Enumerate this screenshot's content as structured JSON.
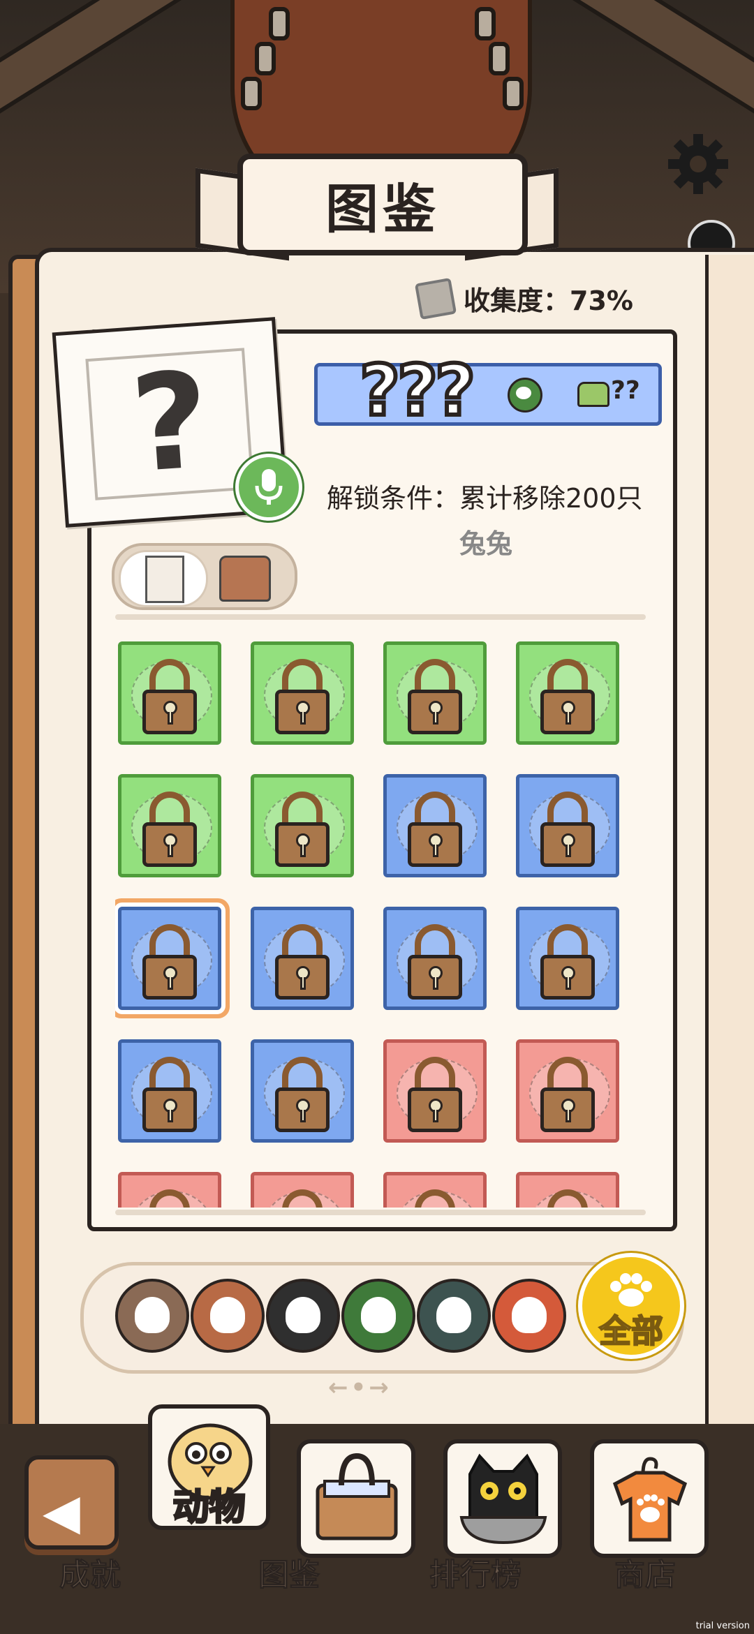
{
  "header": {
    "title": "图鉴"
  },
  "collection": {
    "label": "收集度：73%",
    "progress_percent": 73
  },
  "detail": {
    "name": "???",
    "food_count": "??",
    "photo_symbol": "?",
    "unlock_condition": "解锁条件：累计移除200只",
    "unlock_target": "兔兔"
  },
  "grid": {
    "rows": [
      [
        "green",
        "green",
        "green",
        "green"
      ],
      [
        "green",
        "green",
        "blue",
        "blue"
      ],
      [
        "blue",
        "blue",
        "blue",
        "blue"
      ],
      [
        "blue",
        "blue",
        "red",
        "red"
      ],
      [
        "red",
        "red",
        "red",
        "red"
      ]
    ],
    "selected": [
      2,
      0
    ],
    "colors": {
      "green": "#93e07e",
      "blue": "#7ea8f0",
      "red": "#f39b94"
    }
  },
  "filters": {
    "chips": [
      {
        "icon": "llama-icon",
        "color": "#8a6a55"
      },
      {
        "icon": "bird-icon",
        "color": "#b86a45"
      },
      {
        "icon": "cat-face-icon",
        "color": "#2f2f2f"
      },
      {
        "icon": "frog-icon",
        "color": "#3f7a3a"
      },
      {
        "icon": "turtle-icon",
        "color": "#3d5350"
      },
      {
        "icon": "red-creature-icon",
        "color": "#d45a3a"
      }
    ],
    "all_label": "全部",
    "pager": "←•→"
  },
  "tabs": {
    "active_label": "动物",
    "under_labels": [
      "成就",
      "图鉴",
      "排行榜",
      "商店"
    ]
  },
  "watermark": "trial version"
}
